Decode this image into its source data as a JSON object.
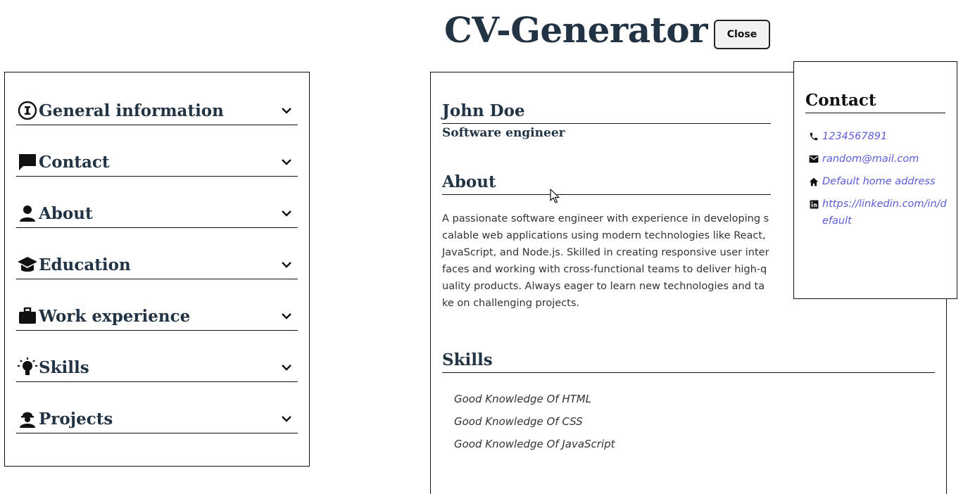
{
  "header": {
    "title": "CV-Generator",
    "close_label": "Close"
  },
  "sidebar": {
    "sections": [
      {
        "label": "General information",
        "icon": "info-icon"
      },
      {
        "label": "Contact",
        "icon": "chat-icon"
      },
      {
        "label": "About",
        "icon": "person-icon"
      },
      {
        "label": "Education",
        "icon": "graduation-cap-icon"
      },
      {
        "label": "Work experience",
        "icon": "briefcase-icon"
      },
      {
        "label": "Skills",
        "icon": "lightbulb-icon"
      },
      {
        "label": "Projects",
        "icon": "engineer-icon"
      }
    ]
  },
  "cv": {
    "name": "John Doe",
    "role": "Software engineer",
    "about_heading": "About",
    "about_text": "A passionate software engineer with experience in developing scalable web applications using modern technologies like React, JavaScript, and Node.js. Skilled in creating responsive user interfaces and working with cross-functional teams to deliver high-quality products. Always eager to learn new technologies and take on challenging projects.",
    "skills_heading": "Skills",
    "skills": [
      "Good Knowledge Of HTML",
      "Good Knowledge Of CSS",
      "Good Knowledge Of JavaScript"
    ],
    "contact": {
      "heading": "Contact",
      "phone": "1234567891",
      "email": "random@mail.com",
      "address": "Default home address",
      "linkedin": "https://linkedin.com/in/default"
    }
  },
  "colors": {
    "heading": "#223344",
    "link": "#5b5bd6",
    "border": "#111111"
  }
}
